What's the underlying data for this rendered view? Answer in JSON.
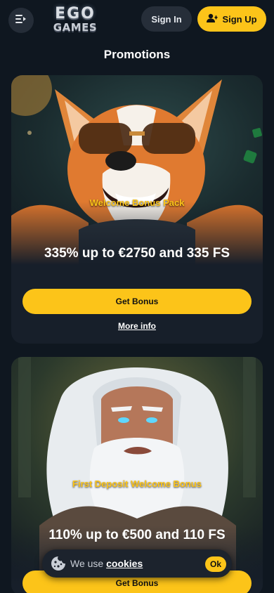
{
  "header": {
    "menu_icon": "menu-collapse-icon",
    "logo_line1": "EGO",
    "logo_line2": "GAMES",
    "signin_label": "Sign In",
    "signup_label": "Sign Up",
    "signup_icon": "user-plus-icon"
  },
  "page": {
    "title": "Promotions"
  },
  "promotions": [
    {
      "label": "Welcome Bonus Pack",
      "amount": "335% up to €2750 and 335 FS",
      "button": "Get Bonus",
      "more_info": "More info"
    },
    {
      "label": "First Deposit Welcome Bonus",
      "amount": "110% up to €500 and 110 FS",
      "button": "Get Bonus"
    }
  ],
  "cookies": {
    "text": "We use ",
    "link": "cookies",
    "ok_label": "Ok",
    "icon": "cookie-icon"
  },
  "colors": {
    "background": "#0f1720",
    "card": "#171f2a",
    "accent": "#fcc419",
    "secondary_button": "#262e39"
  }
}
